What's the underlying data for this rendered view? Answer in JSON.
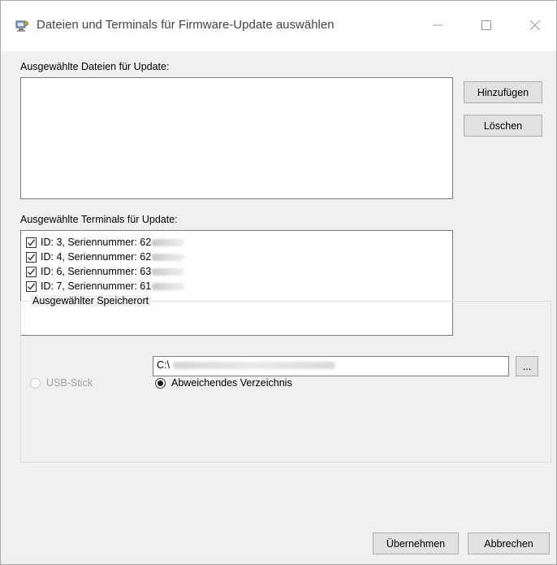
{
  "window": {
    "title": "Dateien und Terminals für Firmware-Update auswählen"
  },
  "files": {
    "label": "Ausgewählte Dateien für Update:",
    "add_label": "Hinzufügen",
    "delete_label": "Löschen"
  },
  "terminals": {
    "label": "Ausgewählte Terminals für Update:",
    "items": [
      {
        "text": "ID: 3, Seriennummer: 62",
        "checked": true
      },
      {
        "text": "ID: 4, Seriennummer: 62",
        "checked": true
      },
      {
        "text": "ID: 6, Seriennummer: 63",
        "checked": true
      },
      {
        "text": "ID: 7, Seriennummer: 61",
        "checked": true
      }
    ]
  },
  "storage": {
    "group_title": "Ausgewählter Speicherort",
    "usb_label": "USB-Stick",
    "usb_selected": false,
    "usb_enabled": false,
    "custom_label": "Abweichendes Verzeichnis",
    "custom_selected": true,
    "path_prefix": "C:\\",
    "browse_label": "..."
  },
  "footer": {
    "apply_label": "Übernehmen",
    "cancel_label": "Abbrechen"
  },
  "colors": {
    "window_bg": "#f0f0f0",
    "titlebar_bg": "#ffffff",
    "button_bg": "#e1e1e1",
    "disabled_text": "#a0a0a0"
  }
}
